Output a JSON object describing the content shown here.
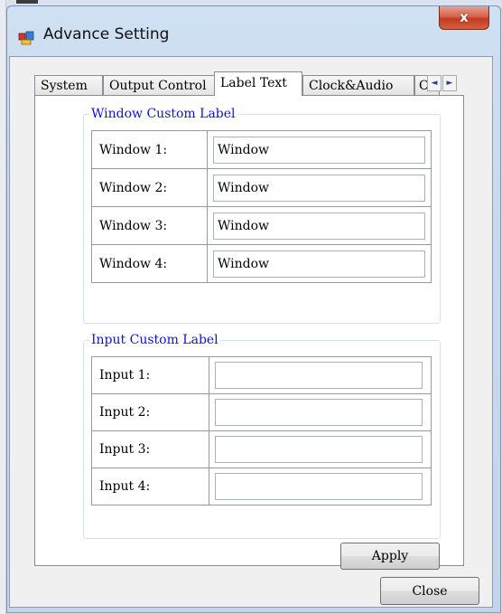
{
  "window": {
    "title": "Advance Setting",
    "close_glyph": "x"
  },
  "tabs": [
    {
      "label": "System",
      "active": false
    },
    {
      "label": "Output Control",
      "active": false
    },
    {
      "label": "Label Text",
      "active": true
    },
    {
      "label": "Clock&Audio",
      "active": false
    },
    {
      "label": "OS",
      "active": false
    }
  ],
  "tab_scroll": {
    "left": "◄",
    "right": "►"
  },
  "window_group": {
    "legend": "Window Custom Label",
    "rows": [
      {
        "label": "Window 1:",
        "value": "Window"
      },
      {
        "label": "Window 2:",
        "value": "Window"
      },
      {
        "label": "Window 3:",
        "value": "Window"
      },
      {
        "label": "Window 4:",
        "value": "Window"
      }
    ]
  },
  "input_group": {
    "legend": "Input Custom Label",
    "rows": [
      {
        "label": "Input 1:",
        "value": ""
      },
      {
        "label": "Input 2:",
        "value": ""
      },
      {
        "label": "Input 3:",
        "value": ""
      },
      {
        "label": "Input 4:",
        "value": ""
      }
    ]
  },
  "buttons": {
    "apply": "Apply",
    "close": "Close"
  },
  "colors": {
    "legend": "#0a12e0",
    "close_button": "#c23b22"
  }
}
